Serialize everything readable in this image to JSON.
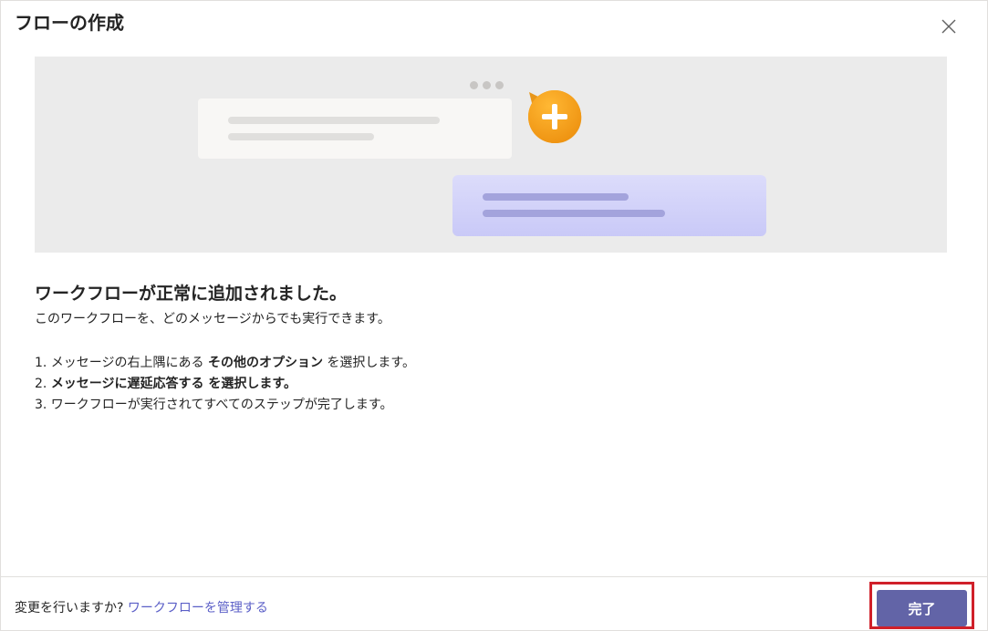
{
  "dialog": {
    "title": "フローの作成",
    "close_icon": "close-icon"
  },
  "content": {
    "heading": "ワークフローが正常に追加されました。",
    "subtext": "このワークフローを、どのメッセージからでも実行できます。",
    "steps": [
      {
        "prefix": "1. メッセージの右上隅にある ",
        "bold": "その他のオプション",
        "suffix": " を選択します。"
      },
      {
        "prefix": "2. ",
        "bold": "メッセージに遅延応答する を選択します。",
        "suffix": ""
      },
      {
        "prefix": "3. ワークフローが実行されてすべてのステップが完了します。",
        "bold": "",
        "suffix": ""
      }
    ]
  },
  "footer": {
    "question": "変更を行いますか? ",
    "manage_link": "ワークフローを管理する",
    "done_label": "完了"
  },
  "colors": {
    "accent": "#6264a7",
    "link": "#5b5fc7",
    "highlight": "#d0202a",
    "plus_bubble": "#f7a21a"
  }
}
